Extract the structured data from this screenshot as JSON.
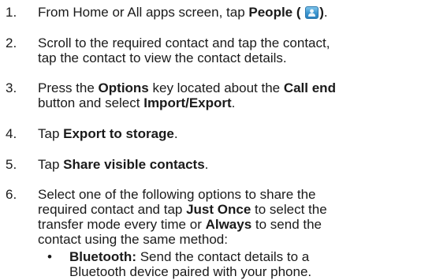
{
  "steps": [
    {
      "number": "1.",
      "lines": [
        {
          "pre": "From Home or All apps screen, tap ",
          "bold1": "People (",
          "icon": "people-app-icon",
          "bold2": ")",
          "post": "."
        }
      ]
    },
    {
      "number": "2.",
      "lines": [
        {
          "text": "Scroll to the required contact and tap the contact,"
        },
        {
          "text": "tap the contact to view the contact details."
        }
      ]
    },
    {
      "number": "3.",
      "lines": [
        {
          "pre": "Press the ",
          "bold1": "Options",
          "mid": " key located about the ",
          "bold2": "Call end"
        },
        {
          "pre": "button and select ",
          "bold1": "Import/Export",
          "post": "."
        }
      ]
    },
    {
      "number": "4.",
      "lines": [
        {
          "pre": "Tap ",
          "bold1": "Export to storage",
          "post": "."
        }
      ]
    },
    {
      "number": "5.",
      "lines": [
        {
          "pre": "Tap ",
          "bold1": "Share visible contacts",
          "post": "."
        }
      ]
    },
    {
      "number": "6.",
      "lines": [
        {
          "text": "Select one of the following options to share the"
        },
        {
          "pre": "required contact and tap ",
          "bold1": "Just Once",
          "post": " to select the"
        },
        {
          "pre": "transfer mode every time or ",
          "bold1": "Always",
          "post": " to send the"
        },
        {
          "text": "contact using the same method:"
        }
      ]
    }
  ],
  "bullets": [
    {
      "symbol": "•",
      "term": "Bluetooth:",
      "line1": " Send the contact details to a",
      "line2": "Bluetooth device paired with your phone."
    }
  ]
}
